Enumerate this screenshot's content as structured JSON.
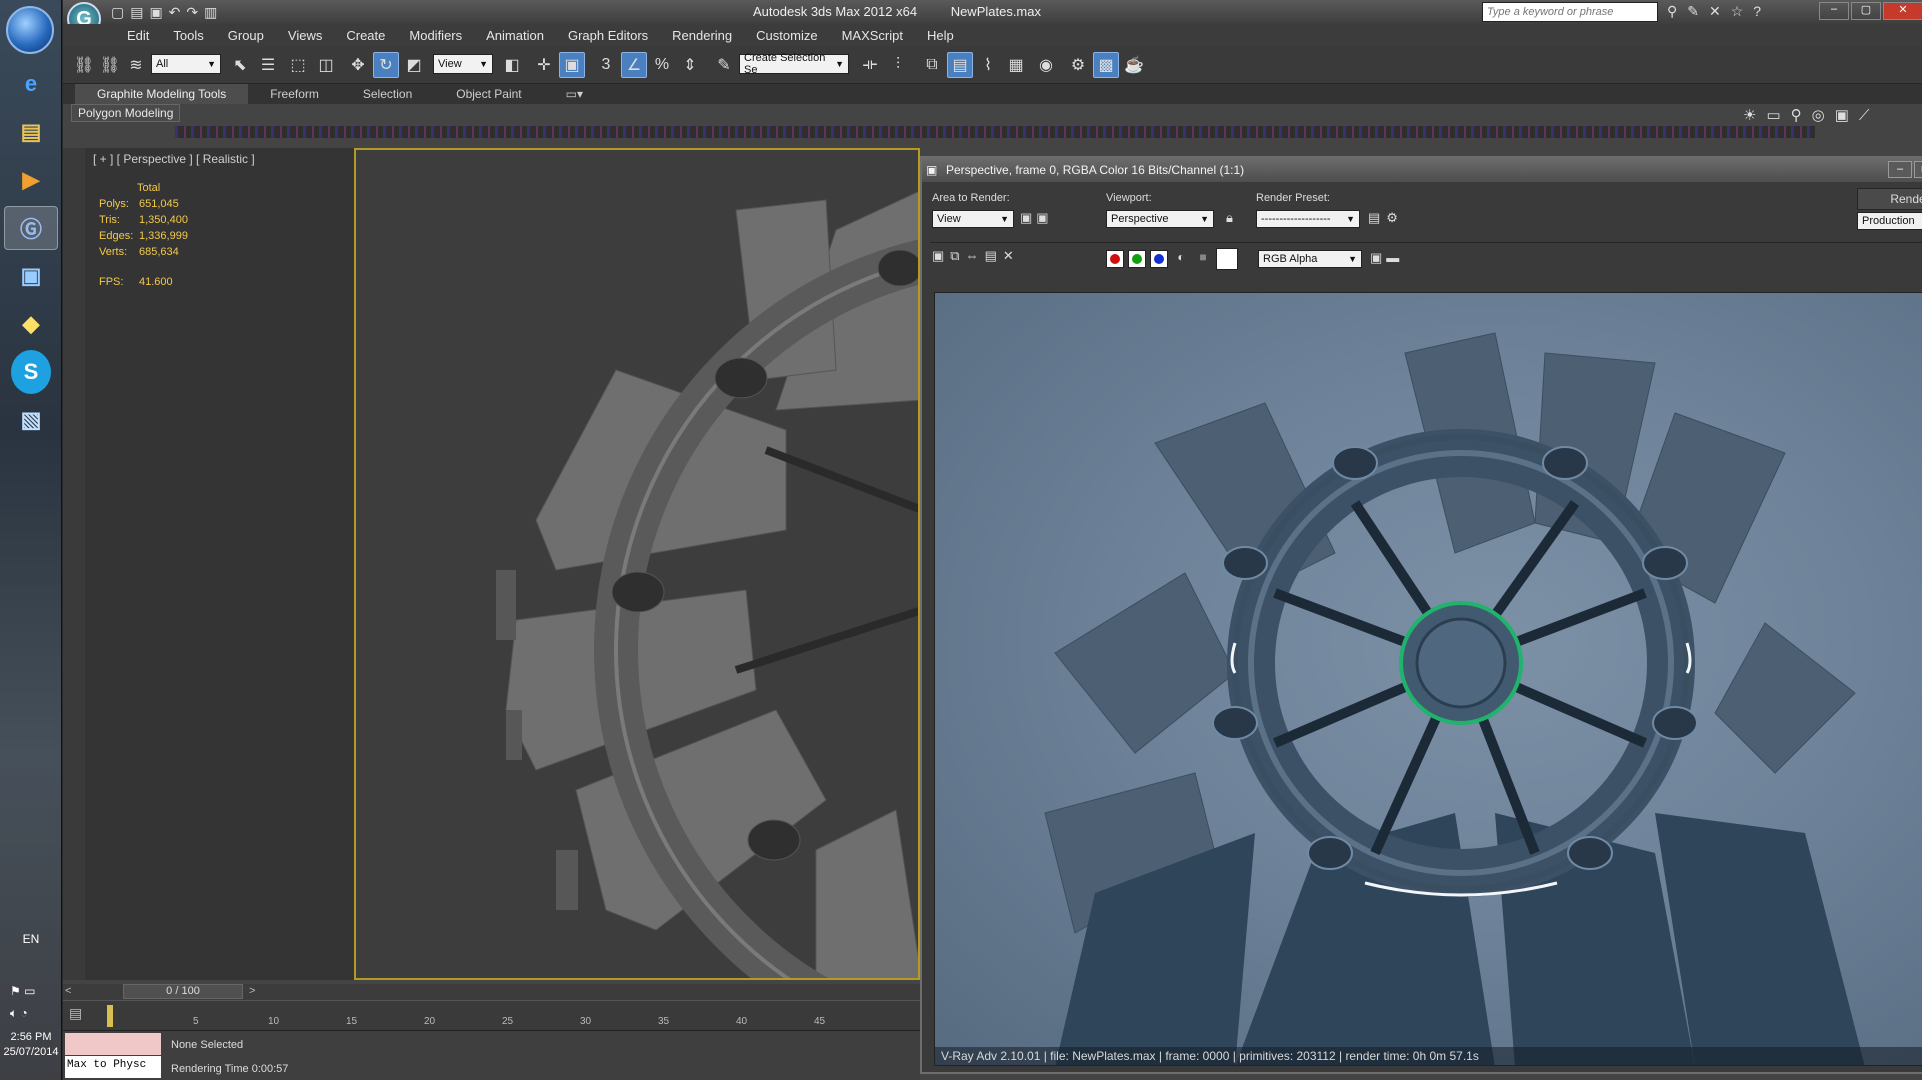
{
  "taskbar": {
    "language": "EN",
    "time": "2:56 PM",
    "date": "25/07/2014"
  },
  "app": {
    "title": "Autodesk 3ds Max  2012 x64",
    "file": "NewPlates.max",
    "search_placeholder": "Type a keyword or phrase"
  },
  "menu": [
    "Edit",
    "Tools",
    "Group",
    "Views",
    "Create",
    "Modifiers",
    "Animation",
    "Graph Editors",
    "Rendering",
    "Customize",
    "MAXScript",
    "Help"
  ],
  "toolbar": {
    "filter_value": "All",
    "coord_value": "View",
    "selection_set_placeholder": "Create Selection Se"
  },
  "ribbon": {
    "tabs": [
      "Graphite Modeling Tools",
      "Freeform",
      "Selection",
      "Object Paint"
    ],
    "panel": "Polygon Modeling"
  },
  "viewport": {
    "label": "[ + ] [ Perspective ] [ Realistic ]",
    "stats_header": "Total",
    "stats": [
      {
        "k": "Polys:",
        "v": "651,045"
      },
      {
        "k": "Tris:",
        "v": "1,350,400"
      },
      {
        "k": "Edges:",
        "v": "1,336,999"
      },
      {
        "k": "Verts:",
        "v": "685,634"
      }
    ],
    "fps_label": "FPS:",
    "fps_value": "41.600"
  },
  "timeline": {
    "frame": "0 / 100",
    "ticks": [
      "5",
      "10",
      "15",
      "20",
      "25",
      "30",
      "35",
      "40",
      "45"
    ]
  },
  "status": {
    "script_listener": "Max to Physc",
    "selection": "None Selected",
    "render_time": "Rendering Time  0:00:57"
  },
  "render_window": {
    "title": "Perspective, frame 0, RGBA Color 16 Bits/Channel (1:1)",
    "area_label": "Area to Render:",
    "area_value": "View",
    "viewport_label": "Viewport:",
    "viewport_value": "Perspective",
    "preset_label": "Render Preset:",
    "preset_value": "-------------------",
    "render_button": "Render",
    "mode_value": "Production",
    "channel_value": "RGB Alpha",
    "caption": "V-Ray Adv 2.10.01 | file: NewPlates.max | frame: 0000 | primitives: 203112 | render time: 0h 0m 57.1s"
  },
  "colors": {
    "viewport_border": "#b59b24",
    "accent": "#4a7fc0",
    "render_bg": "#6e8399",
    "ring_glow": "#1fb36b"
  }
}
